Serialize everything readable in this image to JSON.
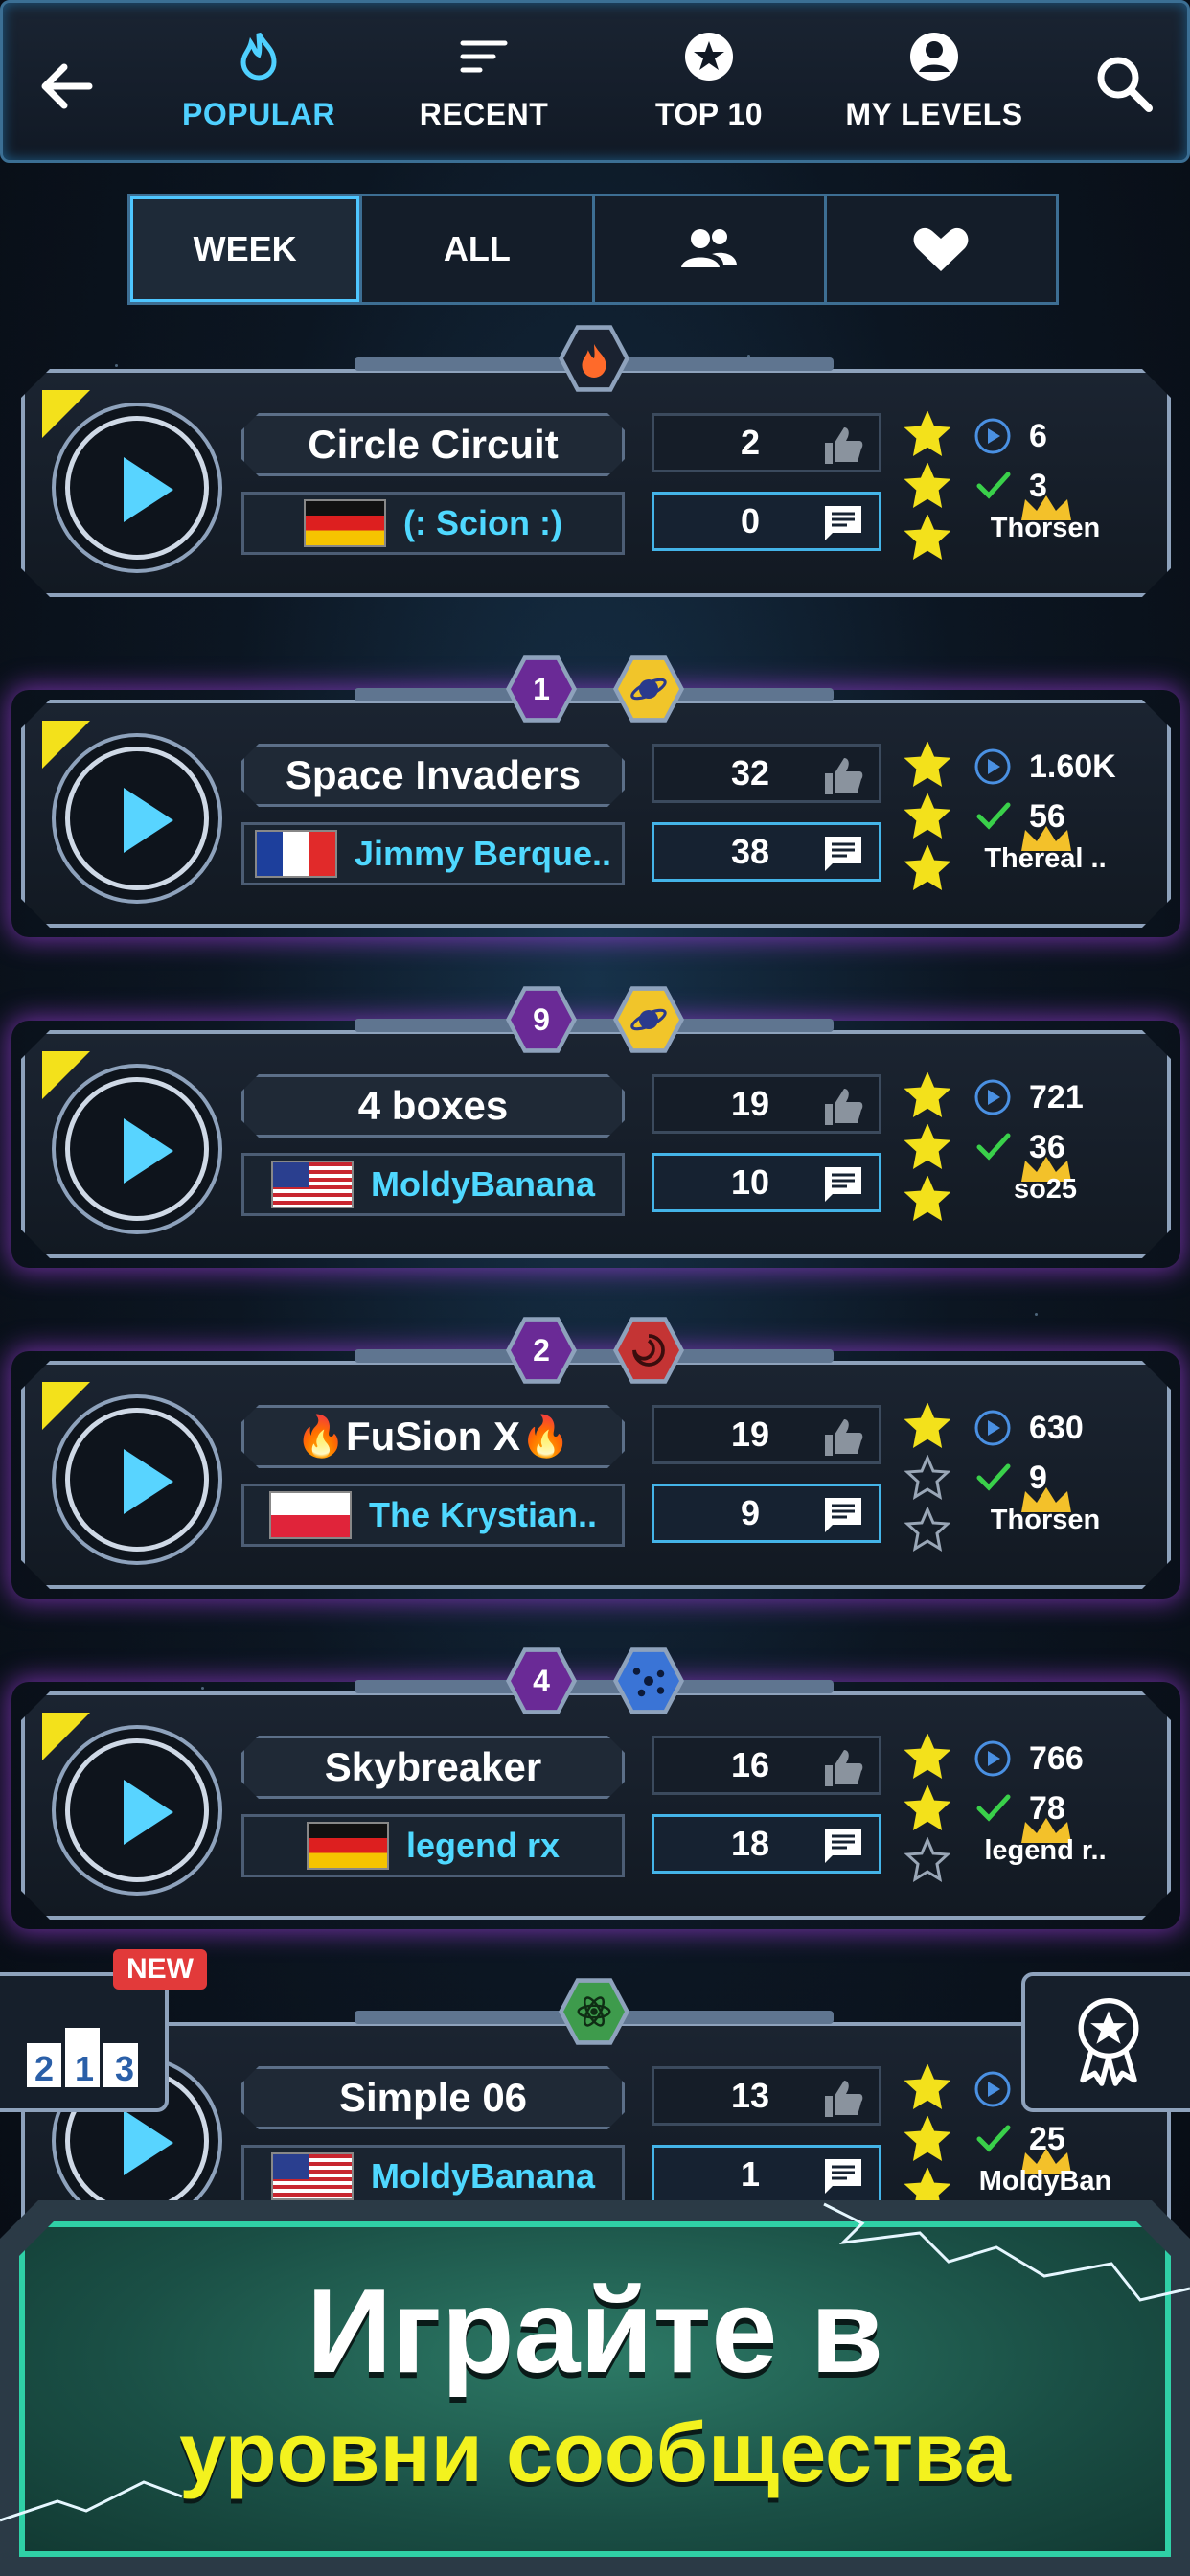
{
  "nav": {
    "tabs": [
      {
        "label": "POPULAR",
        "icon": "flame-icon",
        "active": true
      },
      {
        "label": "RECENT",
        "icon": "sort-lines-icon",
        "active": false
      },
      {
        "label": "TOP 10",
        "icon": "star-badge-icon",
        "active": false
      },
      {
        "label": "MY LEVELS",
        "icon": "user-circle-icon",
        "active": false
      }
    ]
  },
  "filters": [
    {
      "label": "WEEK",
      "active": true
    },
    {
      "label": "ALL",
      "active": false
    },
    {
      "label": "",
      "icon": "friends-icon"
    },
    {
      "label": "",
      "icon": "heart-icon"
    }
  ],
  "levels": [
    {
      "title": "Circle Circuit",
      "author": "(: Scion :)",
      "flag": "de",
      "likes": "2",
      "comments": "0",
      "stars": 3,
      "plays": "6",
      "completions": "3",
      "best": "Thorsen",
      "rank": "",
      "category_icon": "fire-icon",
      "glow": false
    },
    {
      "title": "Space Invaders",
      "author": "Jimmy Berque..",
      "flag": "fr",
      "likes": "32",
      "comments": "38",
      "stars": 3,
      "plays": "1.60K",
      "completions": "56",
      "best": "Thereal ..",
      "rank": "1",
      "category_icon": "planet-icon",
      "glow": true
    },
    {
      "title": "4 boxes",
      "author": "MoldyBanana",
      "flag": "us",
      "likes": "19",
      "comments": "10",
      "stars": 3,
      "plays": "721",
      "completions": "36",
      "best": "so25",
      "rank": "9",
      "category_icon": "planet-icon",
      "glow": true
    },
    {
      "title": "🔥FuSion X🔥",
      "author": "The Krystian..",
      "flag": "pl",
      "likes": "19",
      "comments": "9",
      "stars": 1,
      "plays": "630",
      "completions": "9",
      "best": "Thorsen",
      "rank": "2",
      "category_icon": "vortex-icon",
      "glow": true
    },
    {
      "title": "Skybreaker",
      "author": "legend rx",
      "flag": "de",
      "likes": "16",
      "comments": "18",
      "stars": 2,
      "plays": "766",
      "completions": "78",
      "best": "legend r..",
      "rank": "4",
      "category_icon": "molecule-icon",
      "glow": true
    },
    {
      "title": "Simple 06",
      "author": "MoldyBanana",
      "flag": "us",
      "likes": "13",
      "comments": "1",
      "stars": 3,
      "plays": "",
      "completions": "25",
      "best": "MoldyBan",
      "rank": "",
      "category_icon": "atom-icon",
      "glow": false
    }
  ],
  "side": {
    "new_label": "NEW",
    "podium_label": "213"
  },
  "promo": {
    "line1": "Играйте в",
    "line2": "уровни сообщества"
  },
  "colors": {
    "accent": "#4fd0ff",
    "star": "#f3e11b",
    "purple_glow": "#b846ff",
    "promo_text": "#f3f21e"
  }
}
